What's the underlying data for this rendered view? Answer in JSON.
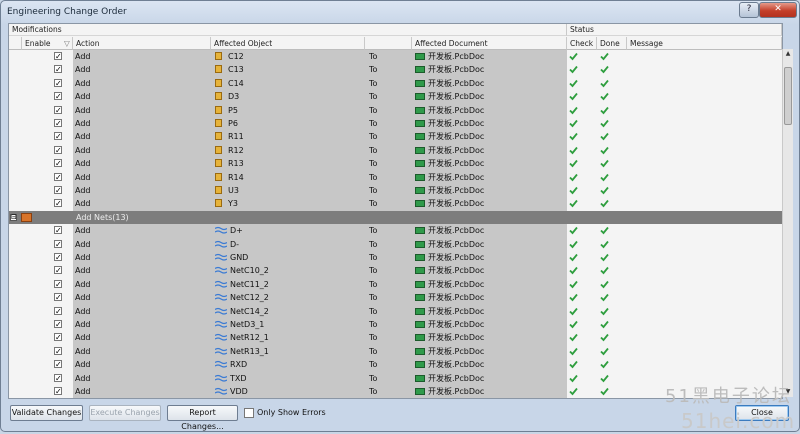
{
  "window": {
    "title": "Engineering Change Order"
  },
  "groups": {
    "modifications": "Modifications",
    "status": "Status"
  },
  "columns": {
    "enable": "Enable",
    "action": "Action",
    "affected_object": "Affected Object",
    "affected_document": "Affected Document",
    "check": "Check",
    "done": "Done",
    "message": "Message"
  },
  "rows": [
    {
      "kind": "item",
      "enabled": true,
      "action": "Add",
      "object": "C12",
      "object_icon": "component-icon",
      "to": "To",
      "document": "开发板.PcbDoc",
      "check": "ok",
      "done": "ok"
    },
    {
      "kind": "item",
      "enabled": true,
      "action": "Add",
      "object": "C13",
      "object_icon": "component-icon",
      "to": "To",
      "document": "开发板.PcbDoc",
      "check": "ok",
      "done": "ok"
    },
    {
      "kind": "item",
      "enabled": true,
      "action": "Add",
      "object": "C14",
      "object_icon": "component-icon",
      "to": "To",
      "document": "开发板.PcbDoc",
      "check": "ok",
      "done": "ok"
    },
    {
      "kind": "item",
      "enabled": true,
      "action": "Add",
      "object": "D3",
      "object_icon": "component-icon",
      "to": "To",
      "document": "开发板.PcbDoc",
      "check": "ok",
      "done": "ok"
    },
    {
      "kind": "item",
      "enabled": true,
      "action": "Add",
      "object": "P5",
      "object_icon": "component-icon",
      "to": "To",
      "document": "开发板.PcbDoc",
      "check": "ok",
      "done": "ok"
    },
    {
      "kind": "item",
      "enabled": true,
      "action": "Add",
      "object": "P6",
      "object_icon": "component-icon",
      "to": "To",
      "document": "开发板.PcbDoc",
      "check": "ok",
      "done": "ok"
    },
    {
      "kind": "item",
      "enabled": true,
      "action": "Add",
      "object": "R11",
      "object_icon": "component-icon",
      "to": "To",
      "document": "开发板.PcbDoc",
      "check": "ok",
      "done": "ok"
    },
    {
      "kind": "item",
      "enabled": true,
      "action": "Add",
      "object": "R12",
      "object_icon": "component-icon",
      "to": "To",
      "document": "开发板.PcbDoc",
      "check": "ok",
      "done": "ok"
    },
    {
      "kind": "item",
      "enabled": true,
      "action": "Add",
      "object": "R13",
      "object_icon": "component-icon",
      "to": "To",
      "document": "开发板.PcbDoc",
      "check": "ok",
      "done": "ok"
    },
    {
      "kind": "item",
      "enabled": true,
      "action": "Add",
      "object": "R14",
      "object_icon": "component-icon",
      "to": "To",
      "document": "开发板.PcbDoc",
      "check": "ok",
      "done": "ok"
    },
    {
      "kind": "item",
      "enabled": true,
      "action": "Add",
      "object": "U3",
      "object_icon": "component-icon",
      "to": "To",
      "document": "开发板.PcbDoc",
      "check": "ok",
      "done": "ok"
    },
    {
      "kind": "item",
      "enabled": true,
      "action": "Add",
      "object": "Y3",
      "object_icon": "component-icon",
      "to": "To",
      "document": "开发板.PcbDoc",
      "check": "ok",
      "done": "ok"
    },
    {
      "kind": "group",
      "label": "Add Nets(13)",
      "expander": "⊟"
    },
    {
      "kind": "item",
      "enabled": true,
      "action": "Add",
      "object": "D+",
      "object_icon": "net-icon",
      "to": "To",
      "document": "开发板.PcbDoc",
      "check": "ok",
      "done": "ok"
    },
    {
      "kind": "item",
      "enabled": true,
      "action": "Add",
      "object": "D-",
      "object_icon": "net-icon",
      "to": "To",
      "document": "开发板.PcbDoc",
      "check": "ok",
      "done": "ok"
    },
    {
      "kind": "item",
      "enabled": true,
      "action": "Add",
      "object": "GND",
      "object_icon": "net-icon",
      "to": "To",
      "document": "开发板.PcbDoc",
      "check": "ok",
      "done": "ok"
    },
    {
      "kind": "item",
      "enabled": true,
      "action": "Add",
      "object": "NetC10_2",
      "object_icon": "net-icon",
      "to": "To",
      "document": "开发板.PcbDoc",
      "check": "ok",
      "done": "ok"
    },
    {
      "kind": "item",
      "enabled": true,
      "action": "Add",
      "object": "NetC11_2",
      "object_icon": "net-icon",
      "to": "To",
      "document": "开发板.PcbDoc",
      "check": "ok",
      "done": "ok"
    },
    {
      "kind": "item",
      "enabled": true,
      "action": "Add",
      "object": "NetC12_2",
      "object_icon": "net-icon",
      "to": "To",
      "document": "开发板.PcbDoc",
      "check": "ok",
      "done": "ok"
    },
    {
      "kind": "item",
      "enabled": true,
      "action": "Add",
      "object": "NetC14_2",
      "object_icon": "net-icon",
      "to": "To",
      "document": "开发板.PcbDoc",
      "check": "ok",
      "done": "ok"
    },
    {
      "kind": "item",
      "enabled": true,
      "action": "Add",
      "object": "NetD3_1",
      "object_icon": "net-icon",
      "to": "To",
      "document": "开发板.PcbDoc",
      "check": "ok",
      "done": "ok"
    },
    {
      "kind": "item",
      "enabled": true,
      "action": "Add",
      "object": "NetR12_1",
      "object_icon": "net-icon",
      "to": "To",
      "document": "开发板.PcbDoc",
      "check": "ok",
      "done": "ok"
    },
    {
      "kind": "item",
      "enabled": true,
      "action": "Add",
      "object": "NetR13_1",
      "object_icon": "net-icon",
      "to": "To",
      "document": "开发板.PcbDoc",
      "check": "ok",
      "done": "ok"
    },
    {
      "kind": "item",
      "enabled": true,
      "action": "Add",
      "object": "RXD",
      "object_icon": "net-icon",
      "to": "To",
      "document": "开发板.PcbDoc",
      "check": "ok",
      "done": "ok"
    },
    {
      "kind": "item",
      "enabled": true,
      "action": "Add",
      "object": "TXD",
      "object_icon": "net-icon",
      "to": "To",
      "document": "开发板.PcbDoc",
      "check": "ok",
      "done": "ok"
    },
    {
      "kind": "item",
      "enabled": true,
      "action": "Add",
      "object": "VDD",
      "object_icon": "net-icon",
      "to": "To",
      "document": "开发板.PcbDoc",
      "check": "ok",
      "done": "ok"
    }
  ],
  "buttons": {
    "validate": "Validate Changes",
    "execute": "Execute Changes",
    "report": "Report Changes...",
    "close": "Close"
  },
  "only_show_errors": {
    "label": "Only Show Errors",
    "checked": false
  },
  "watermark": {
    "line1": "51黑电子论坛",
    "line2": "51hei.com"
  },
  "colors": {
    "ok_green": "#2e9e3e",
    "group_bar": "#7d7d7d",
    "cell_gray": "#c7c7c7"
  }
}
